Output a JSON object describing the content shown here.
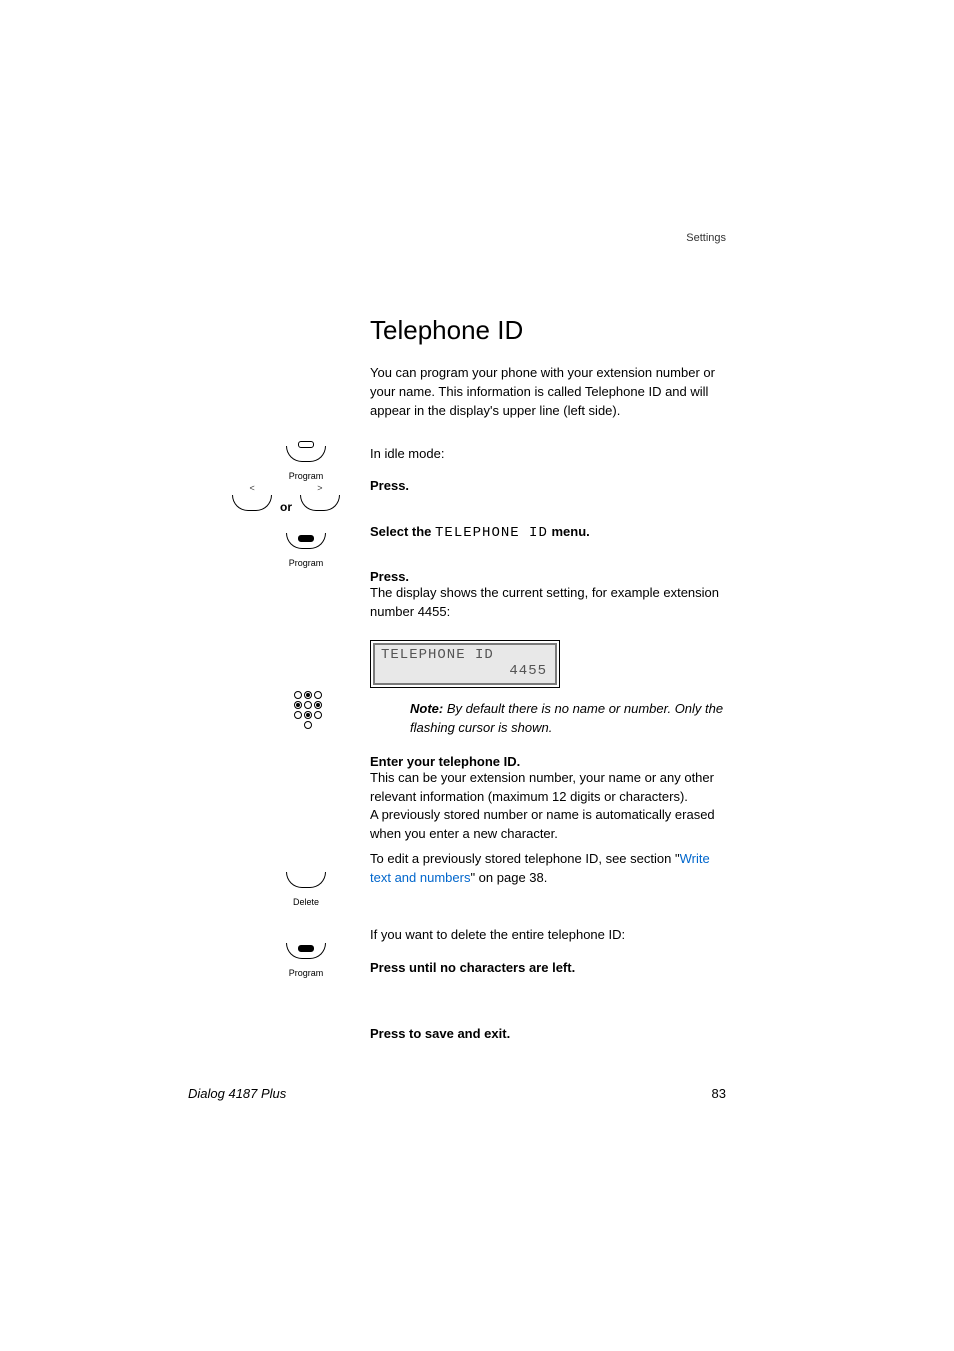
{
  "header": {
    "section_label": "Settings"
  },
  "title": "Telephone ID",
  "intro": "You can program your phone with your extension number or your name. This information is called Telephone ID and will appear in the display's upper line (left side).",
  "idle_mode": "In idle mode:",
  "steps": {
    "press1": {
      "label": "Press.",
      "icon_caption": "Program"
    },
    "select": {
      "prefix": "Select the ",
      "menu_name": "TELEPHONE ID",
      "suffix": " menu.",
      "or_text": "or",
      "left_arrow": "<",
      "right_arrow": ">"
    },
    "press2": {
      "label": "Press.",
      "desc": "The display shows the current setting, for example extension number 4455:",
      "icon_caption": "Program"
    },
    "display": {
      "line1": "TELEPHONE ID",
      "line2": "4455"
    },
    "note": {
      "label": "Note:",
      "text": " By default there is no name or number. Only the flashing cursor is shown."
    },
    "enter_id": {
      "label": "Enter your telephone ID.",
      "desc1": "This can be your extension number, your name or any other relevant information (maximum 12 digits or characters).",
      "desc2": "A previously stored number or name is automatically erased when you enter a new character.",
      "edit_prefix": "To edit a previously stored telephone ID, see section \"",
      "edit_link": "Write text and numbers",
      "edit_suffix": "\" on page 38."
    },
    "delete": {
      "intro": "If you want to delete the entire telephone ID:",
      "label": "Press until no characters are left.",
      "icon_caption": "Delete"
    },
    "save": {
      "label": "Press to save and exit.",
      "icon_caption": "Program"
    }
  },
  "footer": {
    "model": "Dialog 4187 Plus",
    "page": "83"
  }
}
